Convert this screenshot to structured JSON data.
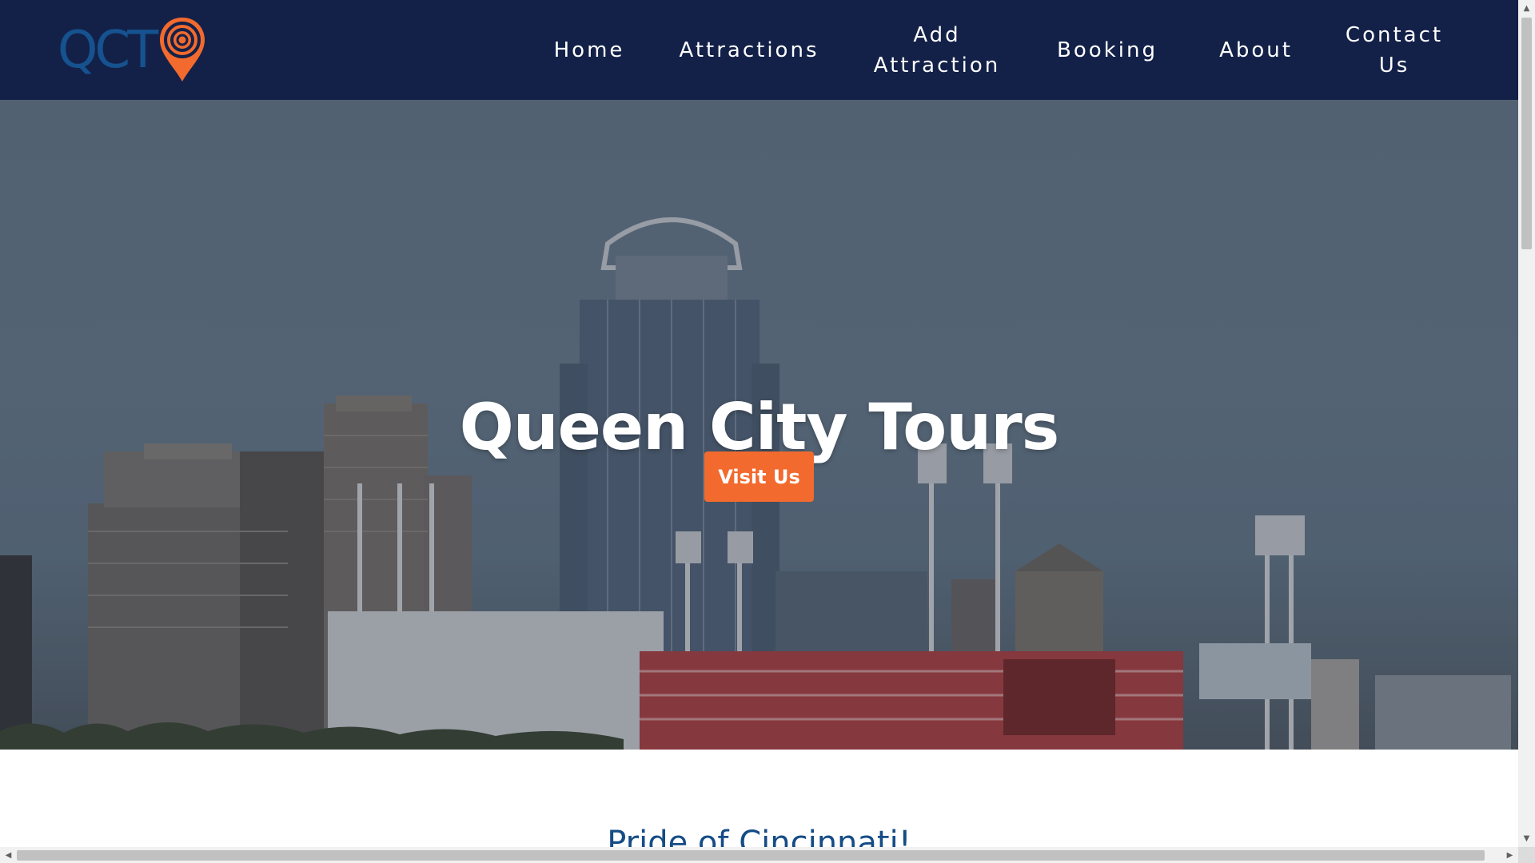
{
  "logo": {
    "text": "QCT",
    "pin_icon": "location-pin-icon",
    "text_color": "#16528f",
    "pin_color": "#f26a2e"
  },
  "nav": {
    "items": [
      {
        "label": "Home"
      },
      {
        "label": "Attractions"
      },
      {
        "label": "Add Attraction"
      },
      {
        "label": "Booking"
      },
      {
        "label": "About"
      },
      {
        "label": "Contact Us"
      }
    ],
    "background": "#132148"
  },
  "hero": {
    "title": "Queen City Tours",
    "button_label": "Visit Us",
    "button_color": "#f26a2e"
  },
  "section": {
    "title": "Pride of Cincinnati!",
    "title_color": "#154c86"
  }
}
